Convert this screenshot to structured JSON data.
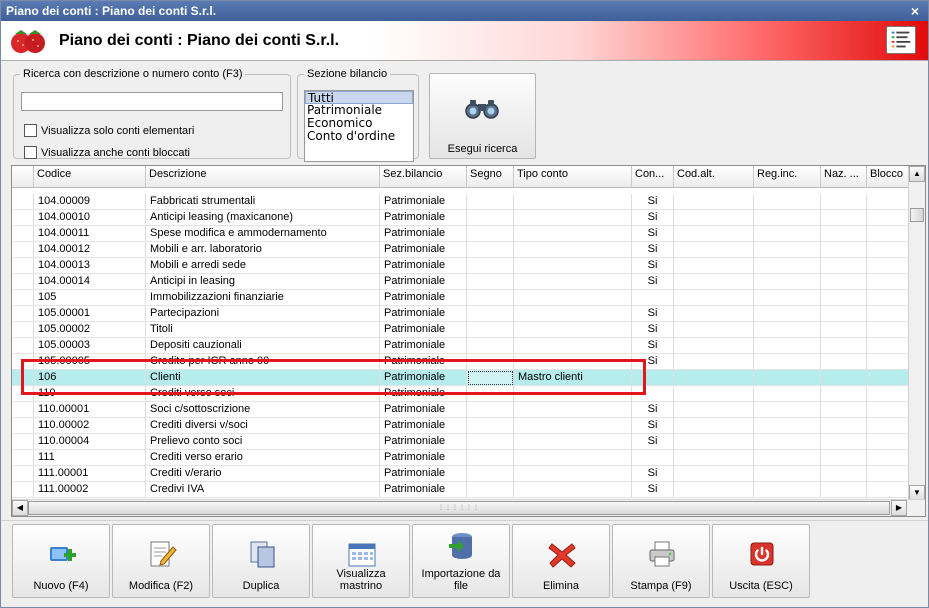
{
  "window": {
    "title": "Piano dei conti : Piano dei conti S.r.l.",
    "close_glyph": "×"
  },
  "banner": {
    "title": "Piano dei conti : Piano dei conti S.r.l."
  },
  "search": {
    "legend": "Ricerca con descrizione o numero conto (F3)",
    "value": "",
    "placeholder": "",
    "checkbox_elementari": "Visualizza solo conti elementari",
    "checkbox_bloccati": "Visualizza anche conti bloccati"
  },
  "sezione": {
    "legend": "Sezione bilancio",
    "options": [
      "Tutti",
      "Patrimoniale",
      "Economico",
      "Conto d'ordine"
    ],
    "selected": "Tutti"
  },
  "search_button": {
    "label": "Esegui ricerca"
  },
  "grid": {
    "columns": [
      "Codice",
      "Descrizione",
      "Sez.bilancio",
      "Segno",
      "Tipo conto",
      "Con...",
      "Cod.alt.",
      "Reg.inc.",
      "Naz. ...",
      "Blocco"
    ],
    "rows": [
      [
        "104.00009",
        "Fabbricati strumentali",
        "Patrimoniale",
        "",
        "",
        "Si",
        "",
        "",
        "",
        ""
      ],
      [
        "104.00010",
        "Anticipi leasing (maxicanone)",
        "Patrimoniale",
        "",
        "",
        "Si",
        "",
        "",
        "",
        ""
      ],
      [
        "104.00011",
        "Spese modifica e ammodernamento",
        "Patrimoniale",
        "",
        "",
        "Si",
        "",
        "",
        "",
        ""
      ],
      [
        "104.00012",
        "Mobili e arr. laboratorio",
        "Patrimoniale",
        "",
        "",
        "Si",
        "",
        "",
        "",
        ""
      ],
      [
        "104.00013",
        "Mobili e arredi sede",
        "Patrimoniale",
        "",
        "",
        "Si",
        "",
        "",
        "",
        ""
      ],
      [
        "104.00014",
        "Anticipi in leasing",
        "Patrimoniale",
        "",
        "",
        "Si",
        "",
        "",
        "",
        ""
      ],
      [
        "105",
        "Immobilizzazioni finanziarie",
        "Patrimoniale",
        "",
        "",
        "",
        "",
        "",
        "",
        ""
      ],
      [
        "105.00001",
        "Partecipazioni",
        "Patrimoniale",
        "",
        "",
        "Si",
        "",
        "",
        "",
        ""
      ],
      [
        "105.00002",
        "Titoli",
        "Patrimoniale",
        "",
        "",
        "Si",
        "",
        "",
        "",
        ""
      ],
      [
        "105.00003",
        "Depositi cauzionali",
        "Patrimoniale",
        "",
        "",
        "Si",
        "",
        "",
        "",
        ""
      ],
      [
        "105.00005",
        "Credito per ICR anno 00",
        "Patrimoniale",
        "",
        "",
        "Si",
        "",
        "",
        "",
        ""
      ],
      [
        "106",
        "Clienti",
        "Patrimoniale",
        "",
        "Mastro clienti",
        "",
        "",
        "",
        "",
        ""
      ],
      [
        "110",
        "Crediti verso soci",
        "Patrimoniale",
        "",
        "",
        "",
        "",
        "",
        "",
        ""
      ],
      [
        "110.00001",
        "Soci c/sottoscrizione",
        "Patrimoniale",
        "",
        "",
        "Si",
        "",
        "",
        "",
        ""
      ],
      [
        "110.00002",
        "Crediti diversi v/soci",
        "Patrimoniale",
        "",
        "",
        "Si",
        "",
        "",
        "",
        ""
      ],
      [
        "110.00004",
        "Prelievo conto soci",
        "Patrimoniale",
        "",
        "",
        "Si",
        "",
        "",
        "",
        ""
      ],
      [
        "111",
        "Crediti verso erario",
        "Patrimoniale",
        "",
        "",
        "",
        "",
        "",
        "",
        ""
      ],
      [
        "111.00001",
        "Crediti v/erario",
        "Patrimoniale",
        "",
        "",
        "Si",
        "",
        "",
        "",
        ""
      ],
      [
        "111.00002",
        "Credivi IVA",
        "Patrimoniale",
        "",
        "",
        "Si",
        "",
        "",
        "",
        ""
      ]
    ],
    "selected_row": 11
  },
  "toolbar": {
    "buttons": [
      {
        "name": "nuovo-button",
        "icon": "new-record-icon",
        "label": "Nuovo (F4)"
      },
      {
        "name": "modifica-button",
        "icon": "edit-pencil-icon",
        "label": "Modifica (F2)"
      },
      {
        "name": "duplica-button",
        "icon": "duplicate-icon",
        "label": "Duplica"
      },
      {
        "name": "visualizza-mastrino-button",
        "icon": "calendar-grid-icon",
        "label": "Visualizza mastrino"
      },
      {
        "name": "importazione-button",
        "icon": "database-import-icon",
        "label": "Importazione da file"
      },
      {
        "name": "elimina-button",
        "icon": "delete-x-icon",
        "label": "Elimina"
      },
      {
        "name": "stampa-button",
        "icon": "printer-icon",
        "label": "Stampa (F9)"
      },
      {
        "name": "uscita-button",
        "icon": "power-icon",
        "label": "Uscita (ESC)"
      }
    ]
  },
  "colors": {
    "title_bar": "#4a6ba6",
    "selected_row": "#b7ecec",
    "annotation_box": "#e2161b",
    "banner_gradient_end": "#e10a0a"
  }
}
